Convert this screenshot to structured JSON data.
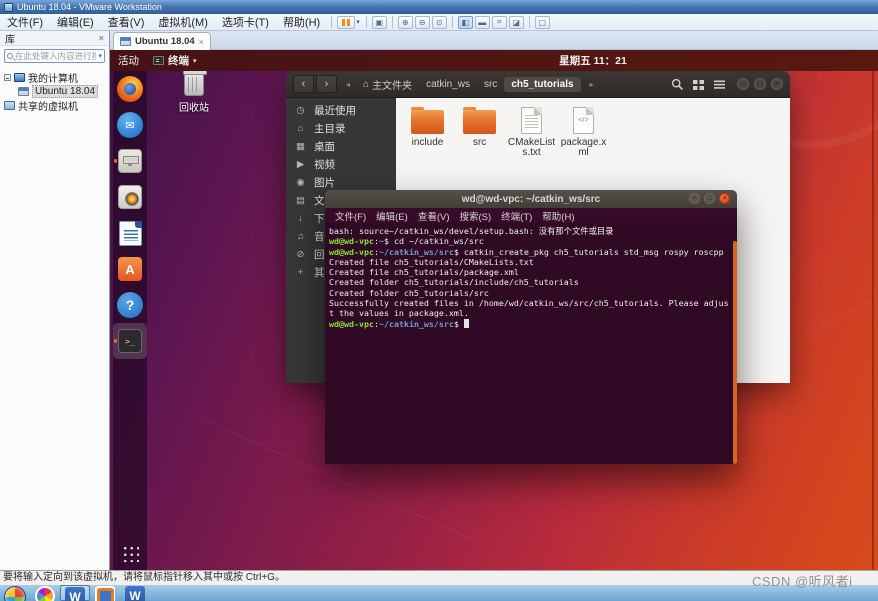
{
  "vmware": {
    "window_title": "Ubuntu 18.04 - VMware Workstation",
    "menu_items": [
      "文件(F)",
      "编辑(E)",
      "查看(V)",
      "虚拟机(M)",
      "选项卡(T)",
      "帮助(H)"
    ],
    "tab_label": "Ubuntu 18.04",
    "tab_close": "×",
    "library": {
      "header": "库",
      "close": "×",
      "search_placeholder": "在此处键入内容进行搜索",
      "tree": [
        {
          "label": "我的计算机",
          "kind": "computer",
          "indent": 0,
          "expander": true,
          "selected": false
        },
        {
          "label": "Ubuntu 18.04",
          "kind": "vm",
          "indent": 1,
          "expander": false,
          "selected": true
        },
        {
          "label": "共享的虚拟机",
          "kind": "shared",
          "indent": 0,
          "expander": false,
          "selected": false
        }
      ]
    },
    "status_text": "要将输入定向到该虚拟机，请将鼠标指针移入其中或按 Ctrl+G。"
  },
  "ubuntu": {
    "topbar": {
      "activities_label": "活动",
      "app_name": "终端",
      "clock": "星期五 11：21"
    },
    "desktop": {
      "trash_label": "回收站"
    },
    "dock": [
      {
        "name": "firefox",
        "glyph": "",
        "running": false,
        "active": false
      },
      {
        "name": "thunderbird",
        "glyph": "✉",
        "running": false,
        "active": false
      },
      {
        "name": "files",
        "glyph": "",
        "running": true,
        "active": false
      },
      {
        "name": "rhythmbox",
        "glyph": "",
        "running": false,
        "active": false
      },
      {
        "name": "libreoffice-writer",
        "glyph": "",
        "running": false,
        "active": false
      },
      {
        "name": "ubuntu-software",
        "glyph": "A",
        "running": false,
        "active": false
      },
      {
        "name": "help",
        "glyph": "?",
        "running": false,
        "active": false
      },
      {
        "name": "terminal",
        "glyph": ">_",
        "running": true,
        "active": true
      }
    ]
  },
  "file_manager": {
    "path_segments": [
      {
        "label": "主文件夹",
        "home": true,
        "active": false
      },
      {
        "label": "catkin_ws",
        "home": false,
        "active": false
      },
      {
        "label": "src",
        "home": false,
        "active": false
      },
      {
        "label": "ch5_tutorials",
        "home": false,
        "active": true
      }
    ],
    "sidebar_items": [
      {
        "icon": "◷",
        "label": "最近使用"
      },
      {
        "icon": "⌂",
        "label": "主目录"
      },
      {
        "icon": "▦",
        "label": "桌面"
      },
      {
        "icon": "▶",
        "label": "视频"
      },
      {
        "icon": "◉",
        "label": "图片"
      },
      {
        "icon": "▤",
        "label": "文档"
      },
      {
        "icon": "↓",
        "label": "下载"
      },
      {
        "icon": "♫",
        "label": "音乐"
      },
      {
        "icon": "⊘",
        "label": "回收站"
      },
      {
        "icon": "+",
        "label": "其他位置"
      }
    ],
    "files": [
      {
        "label": "include",
        "type": "folder"
      },
      {
        "label": "src",
        "type": "folder"
      },
      {
        "label": "CMakeLists.txt",
        "type": "text"
      },
      {
        "label": "package.xml",
        "type": "code"
      }
    ]
  },
  "terminal": {
    "title": "wd@wd-vpc: ~/catkin_ws/src",
    "menu_items": [
      "文件(F)",
      "编辑(E)",
      "查看(V)",
      "搜索(S)",
      "终端(T)",
      "帮助(H)"
    ],
    "colors": {
      "background": "#300a24",
      "prompt_user": "#8ae234",
      "prompt_path": "#729fcf",
      "text": "#eeeeec",
      "scrollbar": "#d4671f"
    },
    "lines": [
      {
        "segs": [
          [
            "w",
            "bash: source~/catkin_ws/devel/setup.bash: 没有那个文件或目录"
          ]
        ],
        "cursor": false
      },
      {
        "segs": [
          [
            "g",
            "wd@wd-vpc"
          ],
          [
            "w",
            ":"
          ],
          [
            "b",
            "~"
          ],
          [
            "w",
            "$ cd ~/catkin_ws/src"
          ]
        ],
        "cursor": false
      },
      {
        "segs": [
          [
            "g",
            "wd@wd-vpc"
          ],
          [
            "w",
            ":"
          ],
          [
            "b",
            "~/catkin_ws/src"
          ],
          [
            "w",
            "$ catkin_create_pkg ch5_tutorials std_msg rospy roscpp"
          ]
        ],
        "cursor": false
      },
      {
        "segs": [
          [
            "w",
            "Created file ch5_tutorials/CMakeLists.txt"
          ]
        ],
        "cursor": false
      },
      {
        "segs": [
          [
            "w",
            "Created file ch5_tutorials/package.xml"
          ]
        ],
        "cursor": false
      },
      {
        "segs": [
          [
            "w",
            "Created folder ch5_tutorials/include/ch5_tutorials"
          ]
        ],
        "cursor": false
      },
      {
        "segs": [
          [
            "w",
            "Created folder ch5_tutorials/src"
          ]
        ],
        "cursor": false
      },
      {
        "segs": [
          [
            "w",
            "Successfully created files in /home/wd/catkin_ws/src/ch5_tutorials. Please adjus"
          ]
        ],
        "cursor": false
      },
      {
        "segs": [
          [
            "w",
            "t the values in package.xml."
          ]
        ],
        "cursor": false
      },
      {
        "segs": [
          [
            "g",
            "wd@wd-vpc"
          ],
          [
            "w",
            ":"
          ],
          [
            "b",
            "~/catkin_ws/src"
          ],
          [
            "w",
            "$ "
          ]
        ],
        "cursor": true
      }
    ]
  },
  "taskbar": {
    "items": [
      {
        "name": "start",
        "glyph": "",
        "pressed": false
      },
      {
        "name": "browser",
        "glyph": "",
        "pressed": false
      },
      {
        "name": "word",
        "glyph": "W",
        "pressed": true
      },
      {
        "name": "app-orange",
        "glyph": "",
        "pressed": false
      },
      {
        "name": "word-2",
        "glyph": "W",
        "pressed": false
      }
    ]
  },
  "watermark": "CSDN @听风者i"
}
